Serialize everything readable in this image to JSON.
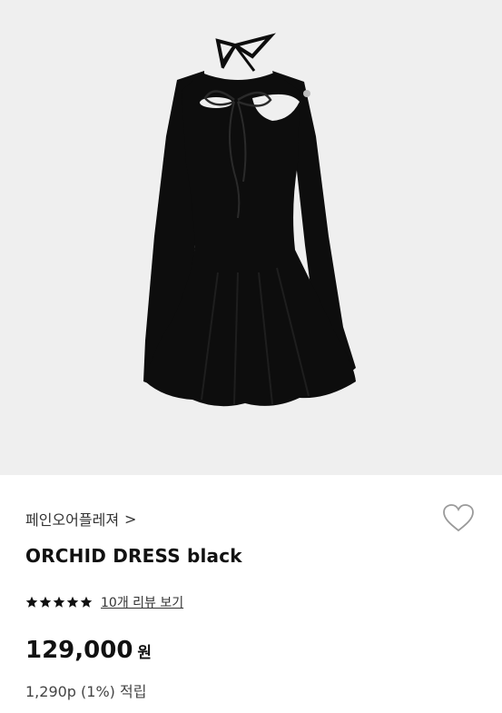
{
  "product": {
    "brand": "페인오어플레져",
    "brand_chevron": ">",
    "name": "ORCHID DRESS black",
    "rating_stars": 5,
    "rating_max": 5,
    "review_link": "10개 리뷰 보기",
    "price": "129,000",
    "currency": "원",
    "points": "1,290p (1%) 적립"
  },
  "colors": {
    "image_background": "#efefef",
    "dress": "#0d0d0d",
    "star": "#111111",
    "heart_outline": "#9a9a9a"
  },
  "icons": {
    "wishlist": "heart-outline-icon",
    "rating": "star-icon",
    "brand_nav": "chevron-right-icon"
  }
}
